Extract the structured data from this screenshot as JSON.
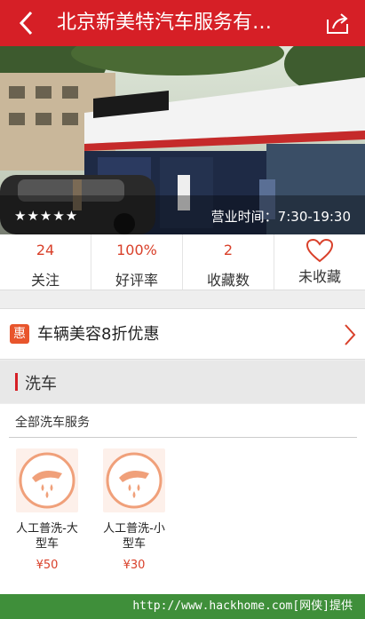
{
  "header": {
    "title": "北京新美特汽车服务有…",
    "back_icon": "chevron-left-icon",
    "share_icon": "share-icon"
  },
  "store": {
    "rating_stars": "★★★★★",
    "rating_value": 5,
    "hours": "营业时间：7:30-19:30"
  },
  "stats": {
    "follow_count": "24",
    "follow_label": "关注",
    "rating_rate": "100%",
    "rating_label": "好评率",
    "favorites_count": "2",
    "favorites_label": "收藏数",
    "favorite_status": "未收藏"
  },
  "promo": {
    "badge": "惠",
    "text": "车辆美容8折优惠"
  },
  "section": {
    "title": "洗车",
    "all_label": "全部洗车服务"
  },
  "services": [
    {
      "name": "人工普洗-大型车",
      "price": "¥50",
      "icon": "car-wash-icon"
    },
    {
      "name": "人工普洗-小型车",
      "price": "¥30",
      "icon": "car-wash-icon"
    }
  ],
  "watermark": "http://www.hackhome.com[网侠]提供",
  "colors": {
    "brand": "#d61f26",
    "accent": "#d9402a",
    "watermark_bg": "#3f8f3a"
  }
}
